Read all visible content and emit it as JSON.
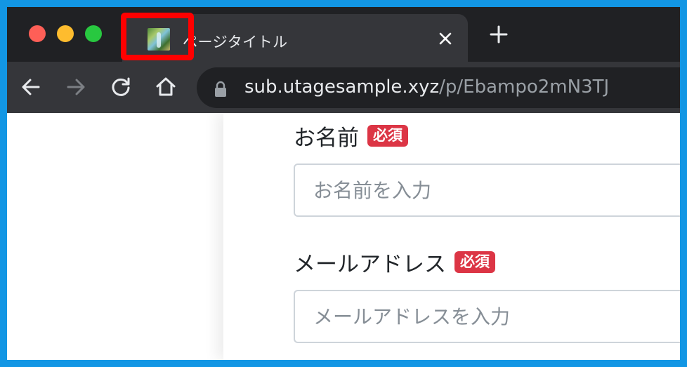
{
  "browser": {
    "tab": {
      "title": "ページタイトル",
      "close_icon": "close-icon",
      "favicon": "page-favicon"
    },
    "new_tab_icon": "plus-icon",
    "toolbar": {
      "back_icon": "arrow-left-icon",
      "forward_icon": "arrow-right-icon",
      "reload_icon": "reload-icon",
      "home_icon": "home-icon"
    },
    "address": {
      "host": "sub.utagesample.xyz",
      "path": "/p/Ebampo2mN3TJ",
      "lock_icon": "lock-icon"
    },
    "highlight_color": "#ff0000"
  },
  "form": {
    "name": {
      "label": "お名前",
      "required_badge": "必須",
      "placeholder": "お名前を入力"
    },
    "email": {
      "label": "メールアドレス",
      "required_badge": "必須",
      "placeholder": "メールアドレスを入力"
    },
    "badge_color": "#dc3545"
  },
  "frame_color": "#1296e4"
}
